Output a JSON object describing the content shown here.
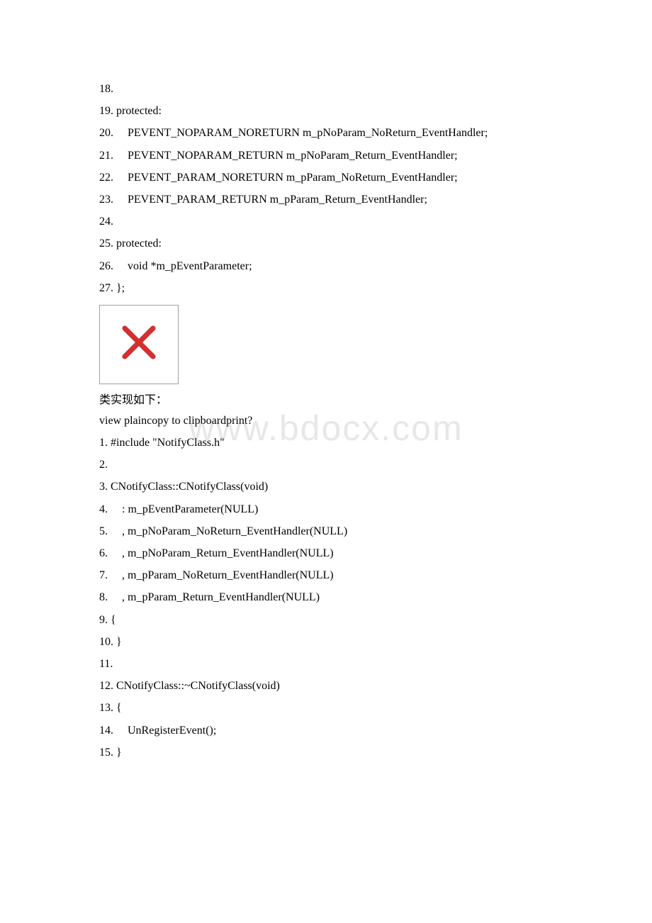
{
  "watermark": "www.bdocx.com",
  "block1": {
    "lines": [
      {
        "n": "18.",
        "t": ""
      },
      {
        "n": "19.",
        "t": "protected:"
      },
      {
        "n": "20.",
        "t": "    PEVENT_NOPARAM_NORETURN m_pNoParam_NoReturn_EventHandler;"
      },
      {
        "n": "21.",
        "t": "    PEVENT_NOPARAM_RETURN m_pNoParam_Return_EventHandler;"
      },
      {
        "n": "22.",
        "t": "    PEVENT_PARAM_NORETURN m_pParam_NoReturn_EventHandler;"
      },
      {
        "n": "23.",
        "t": "    PEVENT_PARAM_RETURN m_pParam_Return_EventHandler;"
      },
      {
        "n": "24.",
        "t": ""
      },
      {
        "n": "25.",
        "t": "protected:"
      },
      {
        "n": "26.",
        "t": "    void *m_pEventParameter;"
      },
      {
        "n": "27.",
        "t": "};"
      }
    ]
  },
  "placeholder_icon": "close-x",
  "chinese_text": "类实现如下：",
  "meta_text": "view plaincopy to clipboardprint?",
  "block2": {
    "lines": [
      {
        "n": "1.",
        "t": "#include \"NotifyClass.h\""
      },
      {
        "n": "2.",
        "t": ""
      },
      {
        "n": "3.",
        "t": "CNotifyClass::CNotifyClass(void)"
      },
      {
        "n": "4.",
        "t": "    : m_pEventParameter(NULL)"
      },
      {
        "n": "5.",
        "t": "    , m_pNoParam_NoReturn_EventHandler(NULL)"
      },
      {
        "n": "6.",
        "t": "    , m_pNoParam_Return_EventHandler(NULL)"
      },
      {
        "n": "7.",
        "t": "    , m_pParam_NoReturn_EventHandler(NULL)"
      },
      {
        "n": "8.",
        "t": "    , m_pParam_Return_EventHandler(NULL)"
      },
      {
        "n": "9.",
        "t": "{"
      },
      {
        "n": "10.",
        "t": "}"
      },
      {
        "n": "11.",
        "t": ""
      },
      {
        "n": "12.",
        "t": "CNotifyClass::~CNotifyClass(void)"
      },
      {
        "n": "13.",
        "t": "{"
      },
      {
        "n": "14.",
        "t": "    UnRegisterEvent();"
      },
      {
        "n": "15.",
        "t": "}"
      }
    ]
  }
}
